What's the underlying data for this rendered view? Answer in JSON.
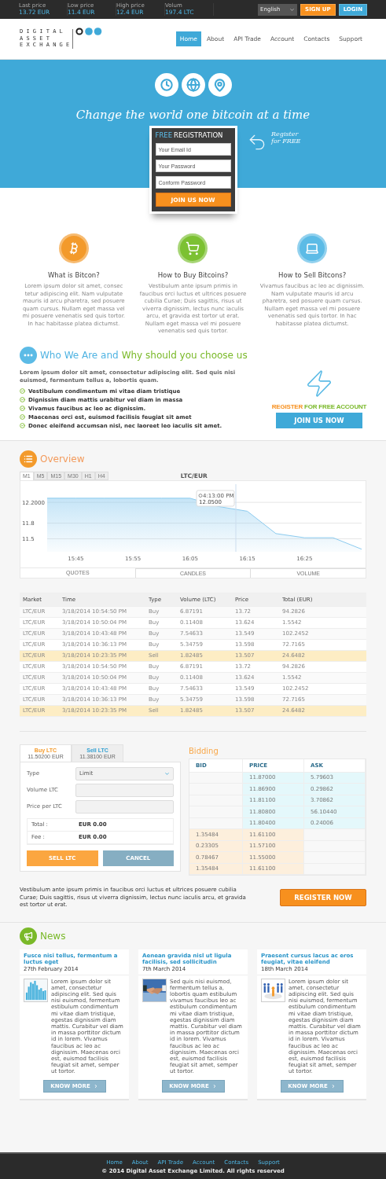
{
  "top_bar": {
    "stats": [
      {
        "label": "Last price",
        "value": "13.72 EUR"
      },
      {
        "label": "Low price",
        "value": "11.4 EUR"
      },
      {
        "label": "High price",
        "value": "12.4 EUR"
      },
      {
        "label": "Volum",
        "value": "197.4 LTC"
      }
    ],
    "language": "English",
    "signup": "SIGN UP",
    "login": "LOGIN"
  },
  "logo": {
    "lines": [
      "D I G I T A L",
      "A S S E T",
      "E X C H A N G E"
    ]
  },
  "nav": [
    {
      "label": "Home",
      "selected": true
    },
    {
      "label": "About",
      "selected": false
    },
    {
      "label": "API Trade",
      "selected": false
    },
    {
      "label": "Account",
      "selected": false
    },
    {
      "label": "Contacts",
      "selected": false
    },
    {
      "label": "Support",
      "selected": false
    }
  ],
  "hero": {
    "slogan": "Change the world one bitcoin at a time",
    "aside": [
      "Register",
      "for FREE"
    ],
    "registration": {
      "title_accent": "FREE",
      "title": "REGISTRATION",
      "fields": [
        {
          "placeholder": "Your Email Id"
        },
        {
          "placeholder": "Your Password"
        },
        {
          "placeholder": "Conform Password"
        }
      ],
      "button": "JOIN US NOW"
    }
  },
  "features": [
    {
      "kind": "bitcoin",
      "title": "What is Bitcon?",
      "text": "Lorem ipsum dolor sit amet, consec tetur adipiscing elit. Nam vulputate mauris id arcu pharetra, sed posuere quam cursus. Nullam eget massa vel mi posuere venenatis sed quis tortor. In hac habitasse platea dictumst."
    },
    {
      "kind": "buy",
      "title": "How to Buy Bitcoins?",
      "text": "Vestibulum ante ipsum primis in faucibus orci luctus et ultrices posuere cubilia Curae; Duis sagittis, risus ut viverra dignissim, lectus nunc iaculis arcu, et gravida est tortor ut erat. Nullam eget massa vel mi posuere venenatis sed quis tortor."
    },
    {
      "kind": "sell",
      "title": "How to Sell Bitcons?",
      "text": "Vivamus faucibus ac leo ac dignissim. Nam vulputate mauris id arcu pharetra, sed posuere quam cursus. Nullam eget massa vel mi posuere venenatis sed quis tortor. In hac habitasse platea dictumst."
    }
  ],
  "about": {
    "title_first": "Who We Are and",
    "title_second": "Why should you choose us",
    "intro": "Lorem ipsum dolor sit amet, consectetur adipiscing elit. Sed quis nisi euismod, fermentum tellus a, lobortis quam.",
    "points": [
      "Vestibulum condimentum mi vitae diam tristique",
      "Dignissim diam mattis urabitur vel diam in massa",
      "Vivamus faucibus ac leo ac dignissim.",
      "Maecenas orci est, euismod facilisis feugiat sit amet",
      "Donec eleifend accumsan nisl, nec laoreet leo iaculis sit amet."
    ],
    "cta_first": "REGISTER",
    "cta_second": "FOR FREE ACCOUNT",
    "button": "JOIN US NOW"
  },
  "overview": {
    "title": "Overview",
    "intervals": [
      {
        "label": "M1",
        "selected": true
      },
      {
        "label": "M5",
        "selected": false
      },
      {
        "label": "M15",
        "selected": false
      },
      {
        "label": "M30",
        "selected": false
      },
      {
        "label": "H1",
        "selected": false
      },
      {
        "label": "H4",
        "selected": false
      }
    ],
    "chart_data": {
      "type": "area",
      "title": "LTC/EUR",
      "grid": true,
      "ylim": [
        11.25,
        12.55
      ],
      "categories": [
        null,
        "15:45",
        null,
        "15:55",
        null,
        "16:05",
        null,
        "16:15",
        null,
        "16:25",
        null,
        null
      ],
      "values": [
        12.28,
        12.28,
        12.28,
        12.28,
        12.28,
        12.28,
        12.12,
        12.03,
        11.6,
        11.52,
        11.52,
        11.3
      ],
      "yticks": [
        {
          "value": 11.5,
          "label": "11.5"
        },
        {
          "value": 11.8,
          "label": "11.8"
        },
        {
          "value": 12.2,
          "label": "12.2000"
        }
      ]
    },
    "tooltip": {
      "time": "4:13:00 PM",
      "value": "12.0500"
    },
    "views": [
      {
        "label": "QUOTES",
        "selected": true
      },
      {
        "label": "CANDLES",
        "selected": false
      },
      {
        "label": "VOLUME",
        "selected": false
      }
    ]
  },
  "trades": {
    "columns": [
      "Market",
      "Time",
      "Type",
      "Volume (LTC)",
      "Price",
      "Total (EUR)"
    ],
    "rows": [
      {
        "cells": [
          "LTC/EUR",
          "3/18/2014 10:54:50 PM",
          "Buy",
          "6.87191",
          "13.72",
          "94.2826"
        ],
        "highlighted": false
      },
      {
        "cells": [
          "LTC/EUR",
          "3/18/2014 10:50:04 PM",
          "Buy",
          "0.11408",
          "13.624",
          "1.5542"
        ],
        "highlighted": false
      },
      {
        "cells": [
          "LTC/EUR",
          "3/18/2014 10:43:48 PM",
          "Buy",
          "7.54633",
          "13.549",
          "102.2452"
        ],
        "highlighted": false
      },
      {
        "cells": [
          "LTC/EUR",
          "3/18/2014 10:36:13 PM",
          "Buy",
          "5.34759",
          "13.598",
          "72.7165"
        ],
        "highlighted": false
      },
      {
        "cells": [
          "LTC/EUR",
          "3/18/2014 10:23:35 PM",
          "Sell",
          "1.82485",
          "13.507",
          "24.6482"
        ],
        "highlighted": true
      },
      {
        "cells": [
          "LTC/EUR",
          "3/18/2014 10:54:50 PM",
          "Buy",
          "6.87191",
          "13.72",
          "94.2826"
        ],
        "highlighted": false
      },
      {
        "cells": [
          "LTC/EUR",
          "3/18/2014 10:50:04 PM",
          "Buy",
          "0.11408",
          "13.624",
          "1.5542"
        ],
        "highlighted": false
      },
      {
        "cells": [
          "LTC/EUR",
          "3/18/2014 10:43:48 PM",
          "Buy",
          "7.54633",
          "13.549",
          "102.2452"
        ],
        "highlighted": false
      },
      {
        "cells": [
          "LTC/EUR",
          "3/18/2014 10:36:13 PM",
          "Buy",
          "5.34759",
          "13.598",
          "72.7165"
        ],
        "highlighted": false
      },
      {
        "cells": [
          "LTC/EUR",
          "3/18/2014 10:23:35 PM",
          "Sell",
          "1.82485",
          "13.507",
          "24.6482"
        ],
        "highlighted": true
      }
    ]
  },
  "order": {
    "tabs": [
      {
        "label": "Buy LTC",
        "price": "11.50200 EUR",
        "selected": true
      },
      {
        "label": "Sell LTC",
        "price": "11.38100 EUR",
        "selected": false
      }
    ],
    "type_label": "Type",
    "type_value": "Limit",
    "volume_label": "Volume LTC",
    "price_label": "Price per LTC",
    "summary": [
      {
        "label": "Total :",
        "value": "EUR 0.00"
      },
      {
        "label": "Fee :",
        "value": "EUR 0.00"
      }
    ],
    "submit": "SELL LTC",
    "cancel": "CANCEL"
  },
  "bidding": {
    "title": "Bidding",
    "columns": [
      "BID",
      "PRICE",
      "ASK"
    ],
    "rows": [
      {
        "kind": "ask",
        "price": "11.87000",
        "amount": "5.79603"
      },
      {
        "kind": "ask",
        "price": "11.86900",
        "amount": "0.29862"
      },
      {
        "kind": "ask",
        "price": "11.81100",
        "amount": "3.70862"
      },
      {
        "kind": "ask",
        "price": "11.80800",
        "amount": "56.10440"
      },
      {
        "kind": "ask",
        "price": "11.80400",
        "amount": "0.24006"
      },
      {
        "kind": "bid",
        "price": "11.61100",
        "amount": "1.35484"
      },
      {
        "kind": "bid",
        "price": "11.57100",
        "amount": "0.23305"
      },
      {
        "kind": "bid",
        "price": "11.55000",
        "amount": "0.78467"
      },
      {
        "kind": "bid",
        "price": "11.61100",
        "amount": "1.35484"
      }
    ]
  },
  "register_bar": {
    "text": "Vestibulum ante ipsum primis in faucibus orci luctus et ultrices posuere cubilia Curae; Duis sagittis, risus ut viverra dignissim, lectus nunc iaculis arcu, et gravida est tortor ut erat.",
    "button": "REGISTER NOW"
  },
  "news": {
    "title": "News",
    "items": [
      {
        "title": "Fusce nisi tellus, fermentum a luctus eget",
        "date": "27th February 2014",
        "text": "Lorem ipsum dolor sit amet, consectetur adipiscing elit. Sed quis nisi euismod, fermentum estibulum condimentum mi vitae diam tristique, egestas dignissim diam mattis. Curabitur vel diam in massa porttitor dictum id in lorem. Vivamus faucibus ac leo ac dignissim. Maecenas orci est, euismod facilisis feugiat sit amet, semper ut tortor.",
        "button": "KNOW MORE"
      },
      {
        "title": "Aenean gravida nisl ut ligula facilisis, sed sollicitudin",
        "date": "7th March 2014",
        "text": "Sed quis nisi euismod, fermentum tellus a, lobortis quam estibulum vivamus faucibus leo ac estibulum condimentum mi vitae diam tristique, egestas dignissim diam mattis. Curabitur vel diam in massa porttitor dictum id in lorem. Vivamus faucibus ac leo ac dignissim. Maecenas orci est, euismod facilisis feugiat sit amet, semper ut tortor.",
        "button": "KNOW MORE"
      },
      {
        "title": "Praesent cursus lacus ac eros feugiat, vitae eleifend",
        "date": "18th March 2014",
        "text": "Lorem ipsum dolor sit amet, consectetur adipiscing elit. Sed quis nisi euismod, fermentum estibulum condimentum mi vitae diam tristique, egestas dignissim diam mattis. Curabitur vel diam in massa porttitor dictum id in lorem. Vivamus faucibus ac leo ac dignissim. Maecenas orci est, euismod facilisis feugiat sit amet, semper ut tortor.",
        "button": "KNOW MORE"
      }
    ]
  },
  "footer": {
    "links": [
      "Home",
      "About",
      "API Trade",
      "Account",
      "Contacts",
      "Support"
    ],
    "copyright": "© 2014 Digital Asset Exchange Limited. All rights reserved"
  }
}
